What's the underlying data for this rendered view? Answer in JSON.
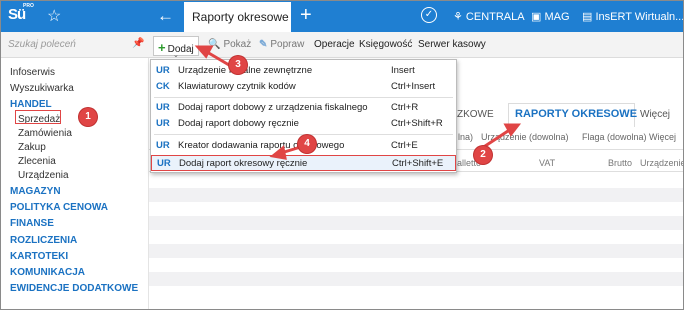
{
  "app": {
    "logo_text": "Sü",
    "logo_superscript": "PRO",
    "active_tab": "Raporty okresowe",
    "top_right": [
      "CENTRALA",
      "MAG",
      "InsERT Wirtualn..."
    ]
  },
  "sidebar": {
    "search_placeholder": "Szukaj poleceń",
    "items": [
      {
        "label": "Infoserwis",
        "type": "plain"
      },
      {
        "label": "Wyszukiwarka",
        "type": "plain"
      },
      {
        "label": "HANDEL",
        "type": "section"
      },
      {
        "label": "Sprzedaż",
        "type": "sub"
      },
      {
        "label": "Zamówienia",
        "type": "sub"
      },
      {
        "label": "Zakup",
        "type": "sub"
      },
      {
        "label": "Zlecenia",
        "type": "sub"
      },
      {
        "label": "Urządzenia",
        "type": "sub"
      },
      {
        "label": "MAGAZYN",
        "type": "section"
      },
      {
        "label": "POLITYKA CENOWA",
        "type": "section"
      },
      {
        "label": "FINANSE",
        "type": "section"
      },
      {
        "label": "ROZLICZENIA",
        "type": "section"
      },
      {
        "label": "KARTOTEKI",
        "type": "section"
      },
      {
        "label": "KOMUNIKACJA",
        "type": "section"
      },
      {
        "label": "EWIDENCJE DODATKOWE",
        "type": "section"
      }
    ]
  },
  "toolbar": {
    "dodaj": "Dodaj",
    "pokaz": "Pokaż",
    "popraw": "Popraw",
    "operacje": "Operacje",
    "ksiegowosc": "Księgowość",
    "serwer": "Serwer kasowy"
  },
  "content": {
    "tab_partial": "ZKOWE",
    "tab_active": "RAPORTY OKRESOWE",
    "tab_more": "Więcej",
    "filters": [
      "lna)",
      "Urządzenie (dowolna)",
      "Flaga (dowolna)",
      "Więcej"
    ],
    "columns": [
      "alletto",
      "VAT",
      "Brutto",
      "Urządzenie"
    ]
  },
  "menu": {
    "items": [
      {
        "code": "UR",
        "label": "Urządzenie fiskalne zewnętrzne",
        "shortcut": "Insert"
      },
      {
        "code": "CK",
        "label": "Klawiaturowy czytnik kodów",
        "shortcut": "Ctrl+Insert"
      },
      {
        "code": "UR",
        "label": "Dodaj raport dobowy z urządzenia fiskalnego",
        "shortcut": "Ctrl+R"
      },
      {
        "code": "UR",
        "label": "Dodaj raport dobowy ręcznie",
        "shortcut": "Ctrl+Shift+R"
      },
      {
        "code": "UR",
        "label": "Kreator dodawania raportu okresowego",
        "shortcut": "Ctrl+E"
      },
      {
        "code": "UR",
        "label": "Dodaj raport okresowy ręcznie",
        "shortcut": "Ctrl+Shift+E"
      }
    ]
  },
  "callouts": [
    "1",
    "2",
    "3",
    "4"
  ],
  "colors": {
    "accent": "#1f7fd2",
    "highlight": "#e04545"
  }
}
